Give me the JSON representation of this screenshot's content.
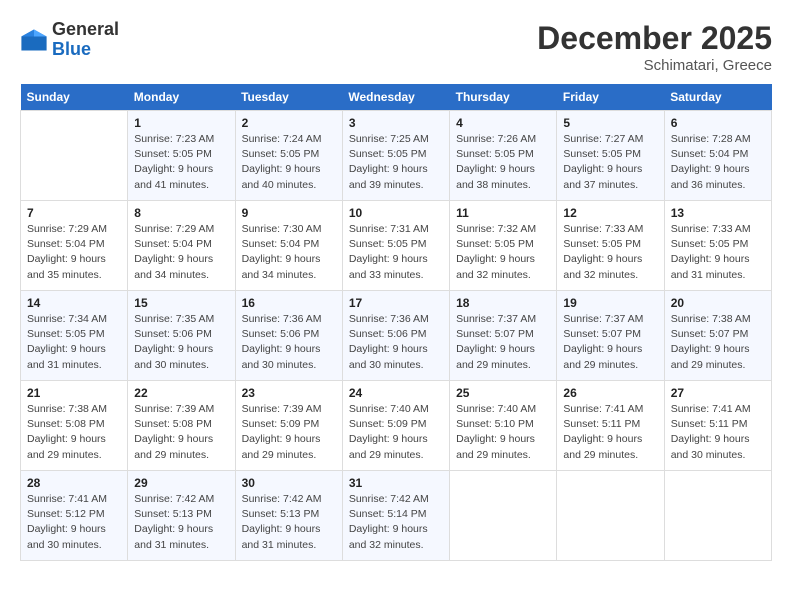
{
  "logo": {
    "general": "General",
    "blue": "Blue"
  },
  "title": "December 2025",
  "location": "Schimatari, Greece",
  "days_of_week": [
    "Sunday",
    "Monday",
    "Tuesday",
    "Wednesday",
    "Thursday",
    "Friday",
    "Saturday"
  ],
  "weeks": [
    [
      {
        "day": "",
        "info": ""
      },
      {
        "day": "1",
        "info": "Sunrise: 7:23 AM\nSunset: 5:05 PM\nDaylight: 9 hours\nand 41 minutes."
      },
      {
        "day": "2",
        "info": "Sunrise: 7:24 AM\nSunset: 5:05 PM\nDaylight: 9 hours\nand 40 minutes."
      },
      {
        "day": "3",
        "info": "Sunrise: 7:25 AM\nSunset: 5:05 PM\nDaylight: 9 hours\nand 39 minutes."
      },
      {
        "day": "4",
        "info": "Sunrise: 7:26 AM\nSunset: 5:05 PM\nDaylight: 9 hours\nand 38 minutes."
      },
      {
        "day": "5",
        "info": "Sunrise: 7:27 AM\nSunset: 5:05 PM\nDaylight: 9 hours\nand 37 minutes."
      },
      {
        "day": "6",
        "info": "Sunrise: 7:28 AM\nSunset: 5:04 PM\nDaylight: 9 hours\nand 36 minutes."
      }
    ],
    [
      {
        "day": "7",
        "info": "Sunrise: 7:29 AM\nSunset: 5:04 PM\nDaylight: 9 hours\nand 35 minutes."
      },
      {
        "day": "8",
        "info": "Sunrise: 7:29 AM\nSunset: 5:04 PM\nDaylight: 9 hours\nand 34 minutes."
      },
      {
        "day": "9",
        "info": "Sunrise: 7:30 AM\nSunset: 5:04 PM\nDaylight: 9 hours\nand 34 minutes."
      },
      {
        "day": "10",
        "info": "Sunrise: 7:31 AM\nSunset: 5:05 PM\nDaylight: 9 hours\nand 33 minutes."
      },
      {
        "day": "11",
        "info": "Sunrise: 7:32 AM\nSunset: 5:05 PM\nDaylight: 9 hours\nand 32 minutes."
      },
      {
        "day": "12",
        "info": "Sunrise: 7:33 AM\nSunset: 5:05 PM\nDaylight: 9 hours\nand 32 minutes."
      },
      {
        "day": "13",
        "info": "Sunrise: 7:33 AM\nSunset: 5:05 PM\nDaylight: 9 hours\nand 31 minutes."
      }
    ],
    [
      {
        "day": "14",
        "info": "Sunrise: 7:34 AM\nSunset: 5:05 PM\nDaylight: 9 hours\nand 31 minutes."
      },
      {
        "day": "15",
        "info": "Sunrise: 7:35 AM\nSunset: 5:06 PM\nDaylight: 9 hours\nand 30 minutes."
      },
      {
        "day": "16",
        "info": "Sunrise: 7:36 AM\nSunset: 5:06 PM\nDaylight: 9 hours\nand 30 minutes."
      },
      {
        "day": "17",
        "info": "Sunrise: 7:36 AM\nSunset: 5:06 PM\nDaylight: 9 hours\nand 30 minutes."
      },
      {
        "day": "18",
        "info": "Sunrise: 7:37 AM\nSunset: 5:07 PM\nDaylight: 9 hours\nand 29 minutes."
      },
      {
        "day": "19",
        "info": "Sunrise: 7:37 AM\nSunset: 5:07 PM\nDaylight: 9 hours\nand 29 minutes."
      },
      {
        "day": "20",
        "info": "Sunrise: 7:38 AM\nSunset: 5:07 PM\nDaylight: 9 hours\nand 29 minutes."
      }
    ],
    [
      {
        "day": "21",
        "info": "Sunrise: 7:38 AM\nSunset: 5:08 PM\nDaylight: 9 hours\nand 29 minutes."
      },
      {
        "day": "22",
        "info": "Sunrise: 7:39 AM\nSunset: 5:08 PM\nDaylight: 9 hours\nand 29 minutes."
      },
      {
        "day": "23",
        "info": "Sunrise: 7:39 AM\nSunset: 5:09 PM\nDaylight: 9 hours\nand 29 minutes."
      },
      {
        "day": "24",
        "info": "Sunrise: 7:40 AM\nSunset: 5:09 PM\nDaylight: 9 hours\nand 29 minutes."
      },
      {
        "day": "25",
        "info": "Sunrise: 7:40 AM\nSunset: 5:10 PM\nDaylight: 9 hours\nand 29 minutes."
      },
      {
        "day": "26",
        "info": "Sunrise: 7:41 AM\nSunset: 5:11 PM\nDaylight: 9 hours\nand 29 minutes."
      },
      {
        "day": "27",
        "info": "Sunrise: 7:41 AM\nSunset: 5:11 PM\nDaylight: 9 hours\nand 30 minutes."
      }
    ],
    [
      {
        "day": "28",
        "info": "Sunrise: 7:41 AM\nSunset: 5:12 PM\nDaylight: 9 hours\nand 30 minutes."
      },
      {
        "day": "29",
        "info": "Sunrise: 7:42 AM\nSunset: 5:13 PM\nDaylight: 9 hours\nand 31 minutes."
      },
      {
        "day": "30",
        "info": "Sunrise: 7:42 AM\nSunset: 5:13 PM\nDaylight: 9 hours\nand 31 minutes."
      },
      {
        "day": "31",
        "info": "Sunrise: 7:42 AM\nSunset: 5:14 PM\nDaylight: 9 hours\nand 32 minutes."
      },
      {
        "day": "",
        "info": ""
      },
      {
        "day": "",
        "info": ""
      },
      {
        "day": "",
        "info": ""
      }
    ]
  ]
}
